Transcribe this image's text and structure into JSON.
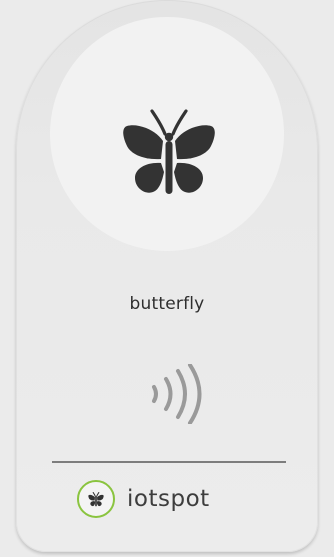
{
  "device": {
    "emblem_icon": "butterfly-icon",
    "label": "butterfly",
    "nfc_icon": "nfc-signal-icon"
  },
  "brand": {
    "logo_icon": "butterfly-icon",
    "name": "iotspot"
  },
  "colors": {
    "device_body": "#e9e9e9",
    "emblem_background": "#f2f2f2",
    "icon_dark": "#333333",
    "nfc_gray": "#9a9a9a",
    "divider": "#7d7d7d",
    "brand_accent": "#8ac43f"
  }
}
